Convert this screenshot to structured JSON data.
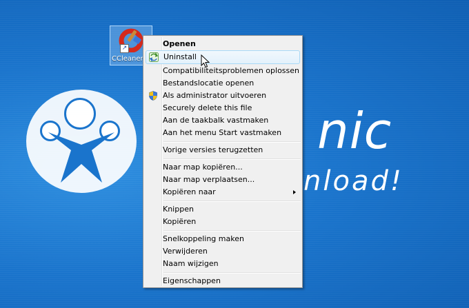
{
  "desktop_icon": {
    "label": "CCleaner"
  },
  "background": {
    "brand_text": "nic",
    "tagline": "nload!"
  },
  "context_menu": {
    "items": [
      {
        "label": "Openen",
        "bold": true
      },
      {
        "label": "Uninstall",
        "highlighted": true,
        "icon": "uninstall-icon"
      },
      {
        "label": "Compatibiliteitsproblemen oplossen"
      },
      {
        "label": "Bestandslocatie openen"
      },
      {
        "label": "Als administrator uitvoeren",
        "icon": "shield-icon"
      },
      {
        "label": "Securely delete this file"
      },
      {
        "label": "Aan de taakbalk vastmaken"
      },
      {
        "label": "Aan het menu Start vastmaken"
      },
      {
        "label": "Vorige versies terugzetten"
      },
      {
        "label": "Naar map kopiëren..."
      },
      {
        "label": "Naar map verplaatsen..."
      },
      {
        "label": "Kopiëren naar",
        "submenu": true
      },
      {
        "label": "Knippen"
      },
      {
        "label": "Kopiëren"
      },
      {
        "label": "Snelkoppeling maken"
      },
      {
        "label": "Verwijderen"
      },
      {
        "label": "Naam wijzigen"
      },
      {
        "label": "Eigenschappen"
      }
    ]
  },
  "colors": {
    "desktop_blue": "#1a74cc",
    "menu_bg": "#f0f0f0",
    "highlight_border": "#a8d8f6"
  }
}
